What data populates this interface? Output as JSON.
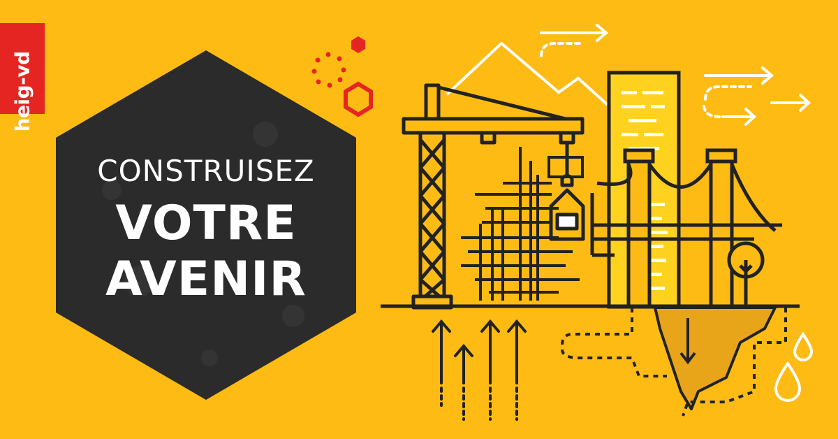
{
  "logo": {
    "text": "heig-vd",
    "color": "#E52521"
  },
  "headline": {
    "line1": "CONSTRUISEZ",
    "line2": "VOTRE",
    "line3": "AVENIR"
  },
  "colors": {
    "background": "#FDBB14",
    "hexagon": "#2B2B2B",
    "accent": "#E52521",
    "ink": "#222222",
    "white": "#FFFFFF"
  },
  "illustration": {
    "icons": [
      "crane-icon",
      "scaffold-icon",
      "tower-icon",
      "bridge-icon",
      "tree-icon",
      "mountain-icon",
      "arrow-right-icon",
      "arrow-up-icon",
      "water-drop-icon"
    ]
  }
}
